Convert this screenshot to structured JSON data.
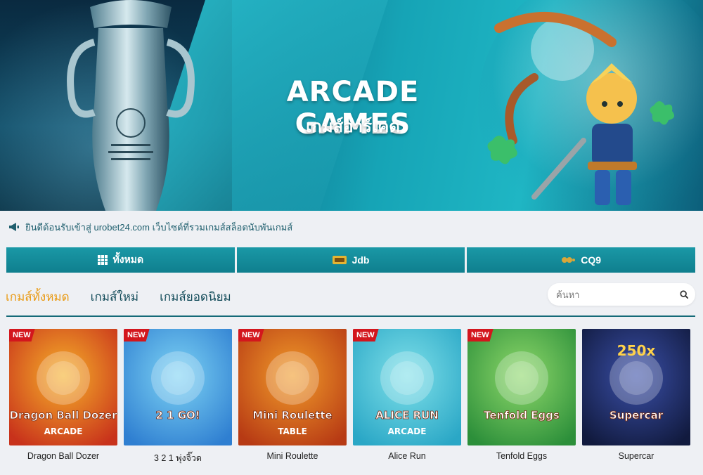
{
  "banner": {
    "title": "ARCADE GAMES",
    "subtitle": "เกมส์อาร์เคด"
  },
  "marquee": {
    "icon": "megaphone-icon",
    "text": "ยินดีต้อนรับเข้าสู่ urobet24.com เว็บไซต์ที่รวมเกมส์สล็อตนับพันเกมส์"
  },
  "providers": [
    {
      "label": "ทั้งหมด",
      "icon": "grid-icon"
    },
    {
      "label": "Jdb",
      "icon": "jdb-logo"
    },
    {
      "label": "CQ9",
      "icon": "cq9-logo"
    }
  ],
  "categories": [
    {
      "label": "เกมส์ทั้งหมด",
      "active": true
    },
    {
      "label": "เกมส์ใหม่",
      "active": false
    },
    {
      "label": "เกมส์ยอดนิยม",
      "active": false
    }
  ],
  "search": {
    "placeholder": "ค้นหา",
    "icon": "search-icon"
  },
  "games": [
    {
      "name": "Dragon Ball Dozer",
      "badge": "NEW",
      "art_title": "Dragon Ball Dozer",
      "art_tag": "ARCADE",
      "bg": [
        "#f6b12a",
        "#c8321b"
      ]
    },
    {
      "name": "3 2 1 พุ่งจิ๊วด",
      "badge": "NEW",
      "art_title": "2 1 GO!",
      "art_tag": "",
      "bg": [
        "#7dd3f4",
        "#2f7fd1"
      ]
    },
    {
      "name": "Mini Roulette",
      "badge": "NEW",
      "art_title": "Mini Roulette",
      "art_tag": "TABLE",
      "bg": [
        "#f19c2a",
        "#b73a14"
      ]
    },
    {
      "name": "Alice Run",
      "badge": "NEW",
      "art_title": "ALICE RUN",
      "art_tag": "ARCADE",
      "bg": [
        "#7fe0e9",
        "#2aa7c6"
      ]
    },
    {
      "name": "Tenfold Eggs",
      "badge": "NEW",
      "art_title": "Tenfold Eggs",
      "art_tag": "",
      "bg": [
        "#8ed86a",
        "#2c8f3a"
      ]
    },
    {
      "name": "Supercar",
      "badge": "",
      "art_title": "Supercar",
      "art_tag": "250x",
      "bg": [
        "#3a4fa8",
        "#111a3e"
      ]
    }
  ]
}
